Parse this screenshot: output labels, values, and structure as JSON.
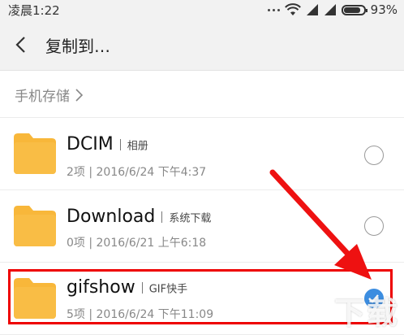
{
  "status_bar": {
    "time": "凌晨1:22",
    "battery_pct": "93%",
    "battery_level": 0.93,
    "icons": [
      "dots-icon",
      "wifi-icon",
      "signal-icon",
      "signal-icon-2",
      "battery-icon"
    ]
  },
  "header": {
    "title": "复制到…",
    "back_icon": "chevron-left-icon"
  },
  "breadcrumb": {
    "label": "手机存储",
    "icon": "chevron-right-icon"
  },
  "folders": [
    {
      "name": "DCIM",
      "tag": "相册",
      "meta": "2项 | 2016/6/24 下午4:37",
      "selected": false
    },
    {
      "name": "Download",
      "tag": "系统下载",
      "meta": "0项 | 2016/6/21 上午6:18",
      "selected": false
    },
    {
      "name": "gifshow",
      "tag": "GIF快手",
      "meta": "5项 | 2016/6/24 下午11:09",
      "selected": true
    }
  ],
  "colors": {
    "folder": "#f8b73a",
    "accent": "#3c8de0",
    "highlight": "#ee0000"
  },
  "watermark": "下载"
}
